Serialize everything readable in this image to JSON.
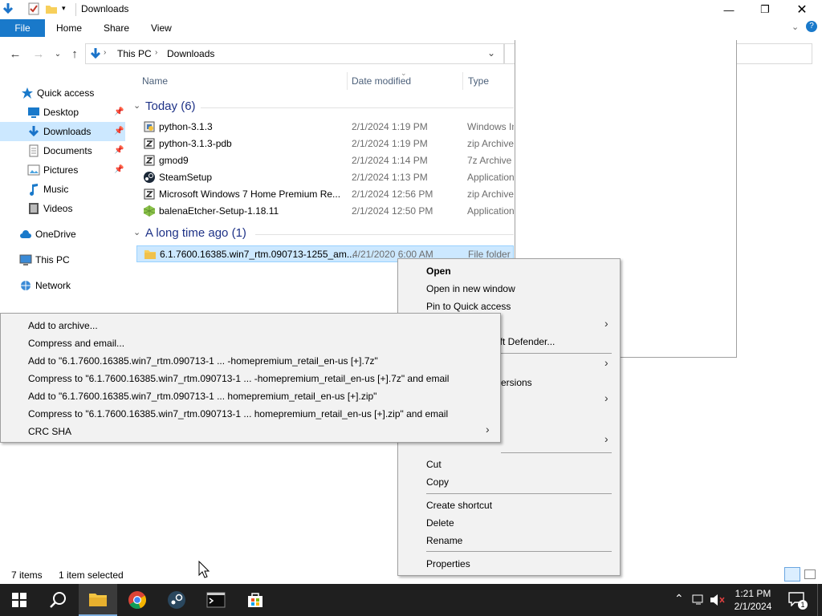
{
  "window": {
    "title": "Downloads"
  },
  "ribbon": {
    "tabs": [
      "File",
      "Home",
      "Share",
      "View"
    ]
  },
  "address": {
    "segments": [
      "This PC",
      "Downloads"
    ]
  },
  "sidebar": {
    "items": [
      {
        "label": "Quick access",
        "icon": "star-icon"
      },
      {
        "label": "Desktop",
        "icon": "desktop-icon",
        "pinned": true
      },
      {
        "label": "Downloads",
        "icon": "download-icon",
        "pinned": true,
        "selected": true
      },
      {
        "label": "Documents",
        "icon": "documents-icon",
        "pinned": true
      },
      {
        "label": "Pictures",
        "icon": "pictures-icon",
        "pinned": true
      },
      {
        "label": "Music",
        "icon": "music-icon"
      },
      {
        "label": "Videos",
        "icon": "videos-icon"
      },
      {
        "label": "OneDrive",
        "icon": "cloud-icon"
      },
      {
        "label": "This PC",
        "icon": "computer-icon"
      },
      {
        "label": "Network",
        "icon": "network-icon"
      }
    ]
  },
  "columns": {
    "name": "Name",
    "date": "Date modified",
    "type": "Type"
  },
  "groups": [
    {
      "label": "Today (6)",
      "files": [
        {
          "name": "python-3.1.3",
          "date": "2/1/2024 1:19 PM",
          "type": "Windows Installer",
          "icon": "installer-icon"
        },
        {
          "name": "python-3.1.3-pdb",
          "date": "2/1/2024 1:19 PM",
          "type": "zip Archive",
          "icon": "archive-icon"
        },
        {
          "name": "gmod9",
          "date": "2/1/2024 1:14 PM",
          "type": "7z Archive",
          "icon": "archive-icon"
        },
        {
          "name": "SteamSetup",
          "date": "2/1/2024 1:13 PM",
          "type": "Application",
          "icon": "steam-icon"
        },
        {
          "name": "Microsoft Windows 7 Home Premium Re...",
          "date": "2/1/2024 12:56 PM",
          "type": "zip Archive",
          "icon": "archive-icon"
        },
        {
          "name": "balenaEtcher-Setup-1.18.11",
          "date": "2/1/2024 12:50 PM",
          "type": "Application",
          "icon": "etcher-icon"
        }
      ]
    },
    {
      "label": "A long time ago (1)",
      "files": [
        {
          "name": "6.1.7600.16385.win7_rtm.090713-1255_am...",
          "date": "4/21/2020 6:00 AM",
          "type": "File folder",
          "icon": "folder-icon",
          "selected": true
        }
      ]
    }
  ],
  "context_menu": {
    "open": "Open",
    "open_new_window": "Open in new window",
    "pin_quick_access": "Pin to Quick access",
    "defender": "oft Defender...",
    "versions": "ersions",
    "cut": "Cut",
    "copy": "Copy",
    "create_shortcut": "Create shortcut",
    "delete": "Delete",
    "rename": "Rename",
    "properties": "Properties"
  },
  "submenu": {
    "items": [
      "Add to archive...",
      "Compress and email...",
      "Add to \"6.1.7600.16385.win7_rtm.090713-1 ... -homepremium_retail_en-us [+].7z\"",
      "Compress to \"6.1.7600.16385.win7_rtm.090713-1 ... -homepremium_retail_en-us [+].7z\" and email",
      "Add to \"6.1.7600.16385.win7_rtm.090713-1 ... homepremium_retail_en-us [+].zip\"",
      "Compress to \"6.1.7600.16385.win7_rtm.090713-1 ... homepremium_retail_en-us [+].zip\" and email",
      "CRC SHA"
    ]
  },
  "status": {
    "items": "7 items",
    "selected": "1 item selected"
  },
  "taskbar": {
    "time": "1:21 PM",
    "date": "2/1/2024",
    "notification_count": "1"
  },
  "colors": {
    "accent": "#1979ca",
    "selection": "#cce8ff",
    "group_heading": "#1e3287",
    "taskbar": "#1f1f1f"
  }
}
